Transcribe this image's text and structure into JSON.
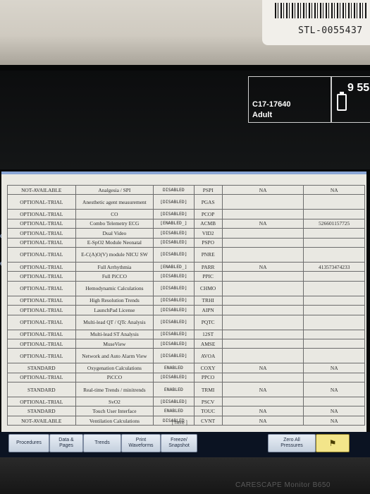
{
  "sticker": {
    "asset_tag": "STL-0055437"
  },
  "monitor": {
    "patient_id": "C17-17640",
    "patient_type": "Adult",
    "clock": "9 55",
    "edge_labels": [
      "ent",
      "e"
    ]
  },
  "license_rows": [
    {
      "availability": "NOT-AVAILABLE",
      "option": "Analgesia / SPI",
      "status": "DISABLED",
      "code": "PSPI",
      "col5": "NA",
      "col6": "NA",
      "tall": false
    },
    {
      "availability": "OPTIONAL-TRIAL",
      "option": "Anesthetic agent measurement",
      "status": "[DISABLED]",
      "code": "PGAS",
      "col5": "",
      "col6": "",
      "tall": true
    },
    {
      "availability": "OPTIONAL-TRIAL",
      "option": "CO",
      "status": "[DISABLED]",
      "code": "PCOP",
      "col5": "",
      "col6": "",
      "tall": false
    },
    {
      "availability": "OPTIONAL-TRIAL",
      "option": "Combo Telemetry ECG",
      "status": "[ENABLED_]",
      "code": "ACMB",
      "col5": "NA",
      "col6": "526601157725",
      "tall": false
    },
    {
      "availability": "OPTIONAL-TRIAL",
      "option": "Dual Video",
      "status": "[DISABLED]",
      "code": "VID2",
      "col5": "",
      "col6": "",
      "tall": false
    },
    {
      "availability": "OPTIONAL-TRIAL",
      "option": "E-SpO2 Module Neonatal",
      "status": "[DISABLED]",
      "code": "PSPO",
      "col5": "",
      "col6": "",
      "tall": false
    },
    {
      "availability": "OPTIONAL-TRIAL",
      "option": "E-C(A)O(V) module NICU SW",
      "status": "[DISABLED]",
      "code": "PNRE",
      "col5": "",
      "col6": "",
      "tall": true
    },
    {
      "availability": "OPTIONAL-TRIAL",
      "option": "Full Arrhythmia",
      "status": "[ENABLED_]",
      "code": "PARR",
      "col5": "NA",
      "col6": "413573474233",
      "tall": false
    },
    {
      "availability": "OPTIONAL-TRIAL",
      "option": "Full PiCCO",
      "status": "[DISABLED]",
      "code": "PPIC",
      "col5": "",
      "col6": "",
      "tall": false
    },
    {
      "availability": "OPTIONAL-TRIAL",
      "option": "Hemodynamic Calculations",
      "status": "[DISABLED]",
      "code": "CHMO",
      "col5": "",
      "col6": "",
      "tall": true
    },
    {
      "availability": "OPTIONAL-TRIAL",
      "option": "High Resolution Trends",
      "status": "[DISABLED]",
      "code": "TRHI",
      "col5": "",
      "col6": "",
      "tall": false
    },
    {
      "availability": "OPTIONAL-TRIAL",
      "option": "LaunchPad License",
      "status": "[DISABLED]",
      "code": "AIPN",
      "col5": "",
      "col6": "",
      "tall": false
    },
    {
      "availability": "OPTIONAL-TRIAL",
      "option": "Multi-lead QT / QTc Analysis",
      "status": "[DISABLED]",
      "code": "PQTC",
      "col5": "",
      "col6": "",
      "tall": true
    },
    {
      "availability": "OPTIONAL-TRIAL",
      "option": "Multi-lead ST Analysis",
      "status": "[DISABLED]",
      "code": "12ST",
      "col5": "",
      "col6": "",
      "tall": false
    },
    {
      "availability": "OPTIONAL-TRIAL",
      "option": "MuseView",
      "status": "[DISABLED]",
      "code": "AMSE",
      "col5": "",
      "col6": "",
      "tall": false
    },
    {
      "availability": "OPTIONAL-TRIAL",
      "option": "Network and Auto Alarm View",
      "status": "[DISABLED]",
      "code": "AVOA",
      "col5": "",
      "col6": "",
      "tall": true
    },
    {
      "availability": "STANDARD",
      "option": "Oxygenation Calculations",
      "status": "ENABLED",
      "code": "COXY",
      "col5": "NA",
      "col6": "NA",
      "tall": false
    },
    {
      "availability": "OPTIONAL-TRIAL",
      "option": "PiCCO",
      "status": "[DISABLED]",
      "code": "PPCO",
      "col5": "",
      "col6": "",
      "tall": false
    },
    {
      "availability": "STANDARD",
      "option": "Real-time Trends / minitrends",
      "status": "ENABLED",
      "code": "TRMI",
      "col5": "NA",
      "col6": "NA",
      "tall": true
    },
    {
      "availability": "OPTIONAL-TRIAL",
      "option": "SvO2",
      "status": "[DISABLED]",
      "code": "PSCV",
      "col5": "",
      "col6": "",
      "tall": false
    },
    {
      "availability": "STANDARD",
      "option": "Touch User Interface",
      "status": "ENABLED",
      "code": "TOUC",
      "col5": "NA",
      "col6": "NA",
      "tall": false
    },
    {
      "availability": "NOT-AVAILABLE",
      "option": "Ventilation Calculations",
      "status": "DISABLED",
      "code": "CVNT",
      "col5": "NA",
      "col6": "NA",
      "tall": false
    }
  ],
  "page_marker": "[ here ]",
  "softkeys": [
    {
      "label": "Procedures"
    },
    {
      "label": "Data &\nPages"
    },
    {
      "label": "Trends"
    },
    {
      "label": "Print\nWaveforms"
    },
    {
      "label": "Freeze/\nSnapshot"
    },
    {
      "label": "Zero All\nPressures"
    }
  ],
  "alarm_icon": "bell-icon",
  "brand": "CARESCAPE Monitor B650"
}
